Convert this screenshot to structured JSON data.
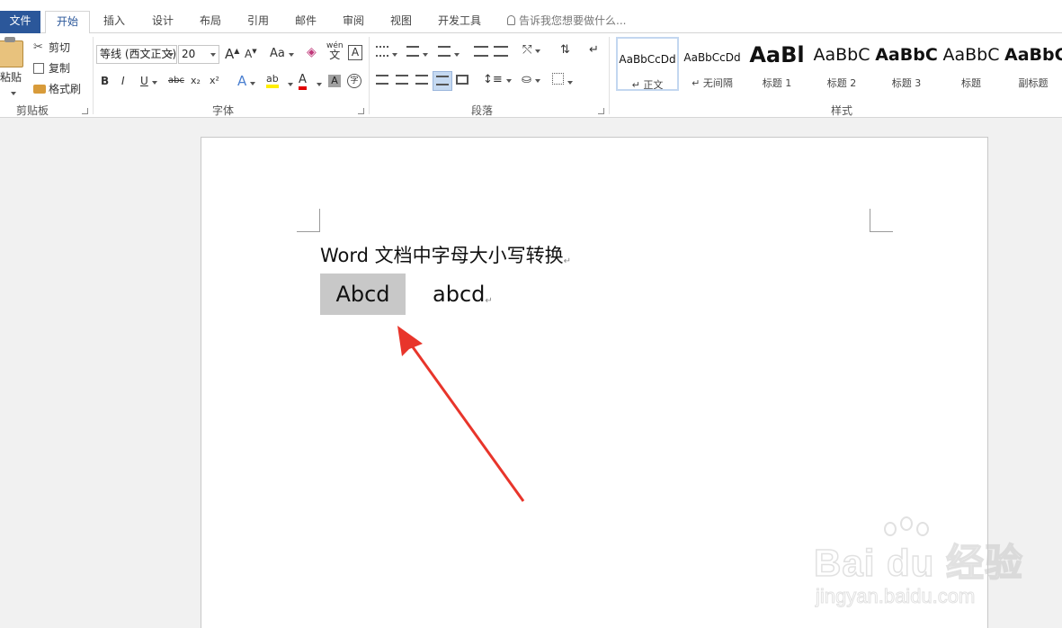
{
  "tabs": {
    "file": "文件",
    "items": [
      "开始",
      "插入",
      "设计",
      "布局",
      "引用",
      "邮件",
      "审阅",
      "视图",
      "开发工具"
    ],
    "tell_me": "告诉我您想要做什么..."
  },
  "clipboard": {
    "paste": "粘贴",
    "cut": "剪切",
    "copy": "复制",
    "format_painter": "格式刷",
    "label": "剪贴板"
  },
  "font": {
    "name": "等线 (西文正文)",
    "size": "20",
    "label": "字体",
    "grow": "A",
    "shrink": "A",
    "change_case": "Aa",
    "phonetic": "wén",
    "phonetic_char": "文",
    "border_char": "A",
    "bold": "B",
    "italic": "I",
    "underline": "U",
    "strike": "abc",
    "subscript": "x₂",
    "superscript": "x²",
    "text_effect": "A",
    "highlight": "ab",
    "font_color": "A",
    "shading": "A",
    "enclose": "字"
  },
  "paragraph": {
    "label": "段落"
  },
  "styles": {
    "label": "样式",
    "items": [
      {
        "preview": "AaBbCcDd",
        "name": "↵ 正文",
        "selected": true
      },
      {
        "preview": "AaBbCcDd",
        "name": "↵ 无间隔",
        "selected": false
      },
      {
        "preview": "AaBl",
        "name": "标题 1",
        "selected": false
      },
      {
        "preview": "AaBbC",
        "name": "标题 2",
        "selected": false
      },
      {
        "preview": "AaBbC",
        "name": "标题 3",
        "selected": false
      },
      {
        "preview": "AaBbC",
        "name": "标题",
        "selected": false
      },
      {
        "preview": "AaBbC",
        "name": "副标题",
        "selected": false
      }
    ]
  },
  "document": {
    "line1": "Word 文档中字母大小写转换",
    "paragraph_mark": "↵",
    "selected_word": "Abcd",
    "word2": "abcd"
  },
  "watermark": {
    "brand": "Bai du 经验",
    "url": "jingyan.baidu.com"
  },
  "colors": {
    "file_tab": "#2b579a",
    "arrow": "#e8352b",
    "selection": "#c8c8c8"
  }
}
